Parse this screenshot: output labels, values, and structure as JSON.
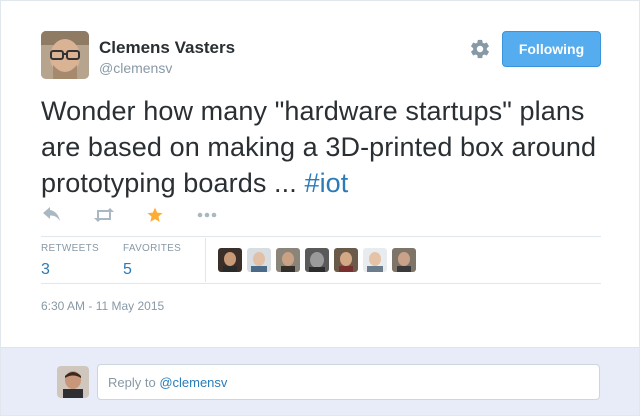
{
  "header": {
    "display_name": "Clemens Vasters",
    "handle": "@clemensv",
    "settings_icon": "gear-icon",
    "follow_button_label": "Following"
  },
  "tweet": {
    "text_main": "Wonder how many \"hardware startups\" plans are based on making a 3D-printed box around prototyping boards ... ",
    "hashtag": "#iot",
    "timestamp": "6:30 AM - 11 May 2015"
  },
  "actions": {
    "reply_icon": "reply-icon",
    "retweet_icon": "retweet-icon",
    "favorite_icon": "star-icon",
    "more_icon": "more-icon"
  },
  "stats": {
    "retweets_label": "RETWEETS",
    "retweets_value": "3",
    "favorites_label": "FAVORITES",
    "favorites_value": "5"
  },
  "engagers": {
    "count": 7
  },
  "reply": {
    "prefix": "Reply to ",
    "mention": "@clemensv"
  },
  "colors": {
    "accent": "#55acee",
    "link": "#2b7bb9",
    "favorite": "#ffac33",
    "muted": "#8899a6",
    "reply_bg": "#e8ecf8"
  }
}
